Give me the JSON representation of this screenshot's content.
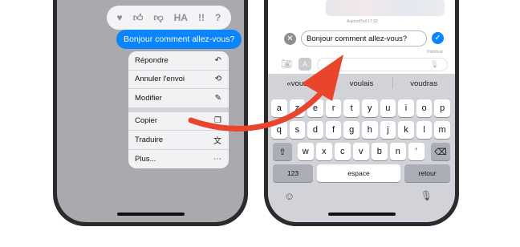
{
  "left": {
    "tapbacks": [
      {
        "icon": "heart-icon",
        "glyph": "♥"
      },
      {
        "icon": "thumbs-up-icon",
        "glyph": "👍︎"
      },
      {
        "icon": "thumbs-down-icon",
        "glyph": "👎︎"
      },
      {
        "icon": "haha-icon",
        "glyph": "HA"
      },
      {
        "icon": "exclamation-icon",
        "glyph": "!!"
      },
      {
        "icon": "question-icon",
        "glyph": "?"
      }
    ],
    "message": "Bonjour comment allez-vous?",
    "menu": [
      {
        "label": "Répondre",
        "icon": "reply-icon",
        "glyph": "↶"
      },
      {
        "label": "Annuler l'envoi",
        "icon": "undo-send-icon",
        "glyph": "⟲"
      },
      {
        "label": "Modifier",
        "icon": "pencil-icon",
        "glyph": "✎"
      },
      {
        "label": "Copier",
        "icon": "copy-icon",
        "glyph": "❐"
      },
      {
        "label": "Traduire",
        "icon": "translate-icon",
        "glyph": "文"
      },
      {
        "label": "Plus...",
        "icon": "more-icon",
        "glyph": "⋯"
      }
    ]
  },
  "right": {
    "top_meta": "Aujourd'hui 17:32",
    "edit_value": "Bonjour comment allez-vous?",
    "delivered": "Distribué",
    "suggestions": [
      "«vous»",
      "voulais",
      "voudras"
    ],
    "keys_row1": [
      "a",
      "z",
      "e",
      "r",
      "t",
      "y",
      "u",
      "i",
      "o",
      "p"
    ],
    "keys_row2": [
      "q",
      "s",
      "d",
      "f",
      "g",
      "h",
      "j",
      "k",
      "l",
      "m"
    ],
    "keys_row3": [
      "w",
      "x",
      "c",
      "v",
      "b",
      "n",
      "’"
    ],
    "key_123": "123",
    "key_space": "espace",
    "key_return": "retour",
    "glyphs": {
      "shift": "⇧",
      "backspace": "⌫",
      "cancel": "✕",
      "confirm": "✓",
      "camera": "📷︎",
      "apps": "A",
      "emoji": "☺",
      "mic": "🎙︎"
    }
  },
  "colors": {
    "accent": "#0a84ff",
    "arrow": "#e8452c"
  }
}
